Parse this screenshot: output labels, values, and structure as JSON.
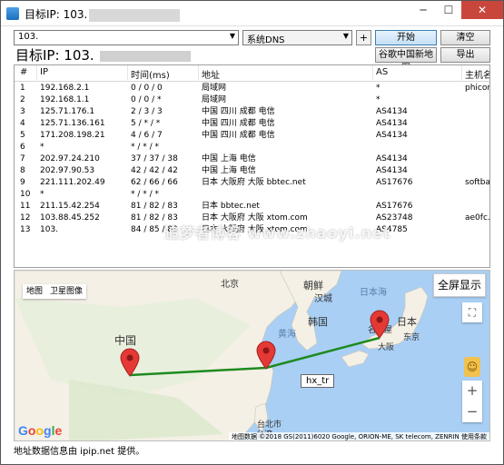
{
  "window": {
    "title": "目标IP: 103.",
    "minimize_glyph": "─",
    "maximize_glyph": "☐",
    "close_glyph": "✕"
  },
  "toolbar": {
    "ip_input_value": "103.",
    "dns_select_value": "系统DNS",
    "plus_label": "+",
    "start_label": "开始",
    "clear_label": "清空",
    "google_map_label": "谷歌中国新地图",
    "export_label": "导出"
  },
  "target": {
    "label": "目标IP:  103."
  },
  "table": {
    "headers": [
      "#",
      "IP",
      "时间(ms)",
      "地址",
      "AS",
      "主机名"
    ],
    "rows": [
      [
        "1",
        "192.168.2.1",
        "0 / 0 / 0",
        "局域网",
        "*",
        "phicomm"
      ],
      [
        "2",
        "192.168.1.1",
        "0 / 0 / *",
        "局域网",
        "*",
        ""
      ],
      [
        "3",
        "125.71.176.1",
        "2 / 3 / 3",
        "中国 四川 成都 电信",
        "AS4134",
        ""
      ],
      [
        "4",
        "125.71.136.161",
        "5 / * / *",
        "中国 四川 成都 电信",
        "AS4134",
        ""
      ],
      [
        "5",
        "171.208.198.21",
        "4 / 6 / 7",
        "中国 四川 成都 电信",
        "AS4134",
        ""
      ],
      [
        "6",
        "*",
        "* / * / *",
        "",
        "",
        ""
      ],
      [
        "7",
        "202.97.24.210",
        "37 / 37 / 38",
        "中国 上海 电信",
        "AS4134",
        ""
      ],
      [
        "8",
        "202.97.90.53",
        "42 / 42 / 42",
        "中国 上海 电信",
        "AS4134",
        ""
      ],
      [
        "9",
        "221.111.202.49",
        "62 / 66 / 66",
        "日本 大阪府 大阪 bbtec.net",
        "AS17676",
        "softbank"
      ],
      [
        "10",
        "*",
        "* / * / *",
        "",
        "",
        ""
      ],
      [
        "11",
        "211.15.42.254",
        "81 / 82 / 83",
        "日本 bbtec.net",
        "AS17676",
        ""
      ],
      [
        "12",
        "103.88.45.252",
        "81 / 82 / 83",
        "日本 大阪府 大阪 xtom.com",
        "AS23748",
        "ae0fc.r"
      ],
      [
        "13",
        "103.",
        "84 / 85 / 83",
        "日本 大阪府 大阪 xtom.com",
        "AS4785",
        ""
      ]
    ]
  },
  "watermark": "追梦者博客 www.zhaoyi.net",
  "map": {
    "type_buttons": [
      "地图",
      "卫星图像"
    ],
    "fullscreen_label": "全屏显示",
    "zoom_in": "+",
    "zoom_out": "−",
    "labels": {
      "beijing": "北京",
      "chaoxian": "朝鲜",
      "hancheng": "汉城",
      "riben_hai": "日本海",
      "hanguo": "韩国",
      "riben": "日本",
      "huanghai": "黄海",
      "zhongguo": "中国",
      "dongjing": "东京",
      "dabanfu": "大阪",
      "mingguwu": "名古屋",
      "shanghai": "上海",
      "taibei": "台北市",
      "taiwan": "台湾"
    },
    "tooltip": "hx_tr",
    "google_logo": "Google",
    "attribution": "地图数据 ©2018 GS(2011)6020 Google, ORION-ME, SK telecom, ZENRIN   使用条款",
    "route_color": "#1e8a1e",
    "pin_color": "#e53935"
  },
  "status": {
    "text": "地址数据信息由 ipip.net 提供。"
  }
}
